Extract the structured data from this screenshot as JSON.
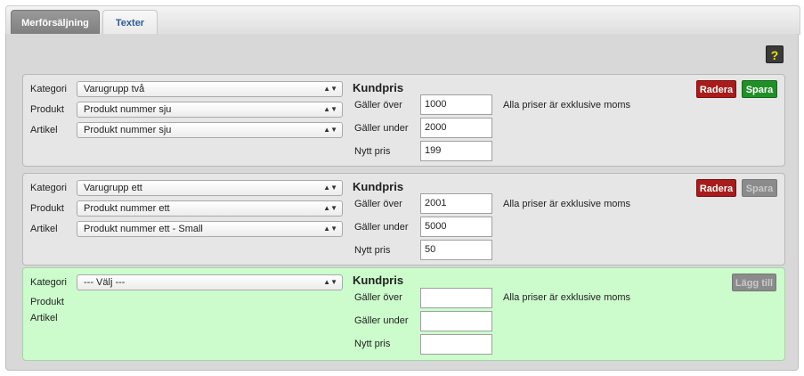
{
  "tabs": [
    {
      "label": "Merförsäljning",
      "active": true
    },
    {
      "label": "Texter",
      "active": false
    }
  ],
  "help_label": "?",
  "labels": {
    "kategori": "Kategori",
    "produkt": "Produkt",
    "artikel": "Artikel",
    "kundpris": "Kundpris",
    "galler_over": "Gäller över",
    "galler_under": "Gäller under",
    "nytt_pris": "Nytt pris",
    "moms_note": "Alla priser är exklusive moms",
    "radera": "Radera",
    "spara": "Spara",
    "lagg_till": "Lägg till"
  },
  "rules": [
    {
      "kategori": "Varugrupp två",
      "produkt": "Produkt nummer sju",
      "artikel": "Produkt nummer sju",
      "galler_over": "1000",
      "galler_under": "2000",
      "nytt_pris": "199",
      "save_enabled": true
    },
    {
      "kategori": "Varugrupp ett",
      "produkt": "Produkt nummer ett",
      "artikel": "Produkt nummer ett - Small",
      "galler_over": "2001",
      "galler_under": "5000",
      "nytt_pris": "50",
      "save_enabled": false
    }
  ],
  "new_rule": {
    "kategori": "--- Välj ---",
    "galler_over": "",
    "galler_under": "",
    "nytt_pris": ""
  },
  "colors": {
    "new_rule_bg": "#ccfccc",
    "delete_button": "#a81c1c",
    "save_button": "#1f8f26",
    "disabled_button": "#8b8b8b",
    "help_icon": "#f2e600"
  }
}
